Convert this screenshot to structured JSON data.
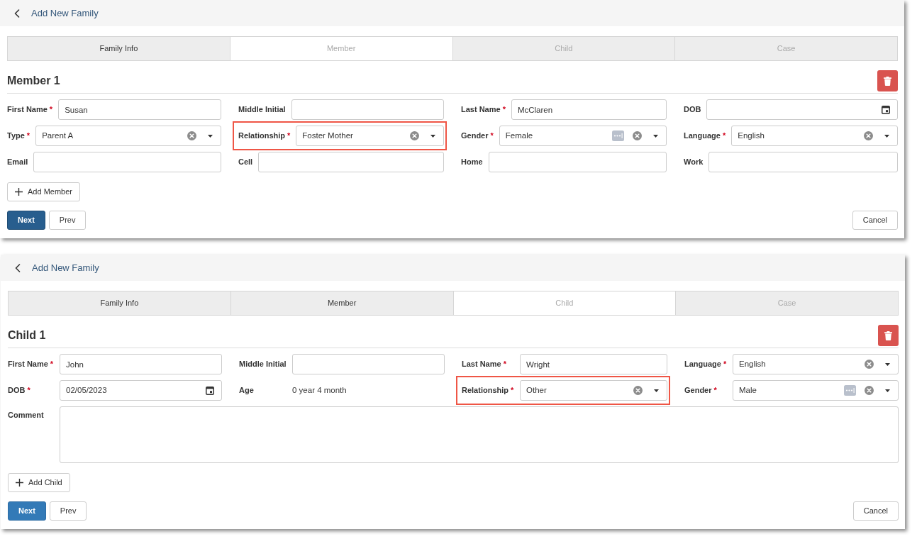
{
  "panels": [
    {
      "header": {
        "title": "Add New Family"
      },
      "tabs": [
        {
          "label": "Family Info",
          "selected": false,
          "completed": true
        },
        {
          "label": "Member",
          "selected": true,
          "completed": false
        },
        {
          "label": "Child",
          "selected": false,
          "completed": false
        },
        {
          "label": "Case",
          "selected": false,
          "completed": false
        }
      ],
      "section_title": "Member 1",
      "aligned_labels": false,
      "rows": [
        [
          {
            "kind": "text",
            "label": "First Name",
            "required_mark": "*",
            "value": "Susan",
            "highlighted": false
          },
          {
            "kind": "text",
            "label": "Middle Initial",
            "highlighted": false
          },
          {
            "kind": "text",
            "label": "Last Name",
            "required_mark": "*",
            "value": "McClaren",
            "highlighted": false
          },
          {
            "kind": "date",
            "label": "DOB",
            "highlighted": false
          }
        ],
        [
          {
            "kind": "select",
            "label": "Type",
            "required_mark": "*",
            "value": "Parent A",
            "more": false,
            "highlighted": false
          },
          {
            "kind": "select",
            "label": "Relationship",
            "required_mark": "*",
            "value": "Foster Mother",
            "more": false,
            "highlighted": true
          },
          {
            "kind": "select",
            "label": "Gender",
            "required_mark": "*",
            "value": "Female",
            "more": true,
            "highlighted": false
          },
          {
            "kind": "select",
            "label": "Language",
            "required_mark": "*",
            "value": "English",
            "more": false,
            "highlighted": false
          }
        ],
        [
          {
            "kind": "text",
            "label": "Email",
            "highlighted": false
          },
          {
            "kind": "text",
            "label": "Cell",
            "highlighted": false
          },
          {
            "kind": "text",
            "label": "Home",
            "highlighted": false
          },
          {
            "kind": "text",
            "label": "Work",
            "highlighted": false
          }
        ]
      ],
      "add_button": "Add Member",
      "next_button": {
        "label": "Next",
        "active": true
      },
      "prev_button": "Prev",
      "cancel_button": "Cancel"
    },
    {
      "header": {
        "title": "Add New Family"
      },
      "tabs": [
        {
          "label": "Family Info",
          "selected": false,
          "completed": true
        },
        {
          "label": "Member",
          "selected": false,
          "completed": true
        },
        {
          "label": "Child",
          "selected": true,
          "completed": false
        },
        {
          "label": "Case",
          "selected": false,
          "completed": false
        }
      ],
      "section_title": "Child 1",
      "aligned_labels": true,
      "rows": [
        [
          {
            "kind": "text",
            "label": "First Name",
            "required_mark": "*",
            "value": "John",
            "highlighted": false
          },
          {
            "kind": "text",
            "label": "Middle Initial",
            "highlighted": false
          },
          {
            "kind": "text",
            "label": "Last Name",
            "required_mark": "*",
            "value": "Wright",
            "highlighted": false
          },
          {
            "kind": "select",
            "label": "Language",
            "required_mark": "*",
            "value": "English",
            "more": false,
            "highlighted": false
          }
        ],
        [
          {
            "kind": "date",
            "label": "DOB",
            "required_mark": "*",
            "value": "02/05/2023",
            "highlighted": false
          },
          {
            "kind": "static",
            "label": "Age",
            "value": "0 year 4 month",
            "highlighted": false
          },
          {
            "kind": "select",
            "label": "Relationship",
            "required_mark": "*",
            "value": "Other",
            "more": false,
            "highlighted": true
          },
          {
            "kind": "select",
            "label": "Gender",
            "required_mark": "*",
            "value": "Male",
            "more": true,
            "highlighted": false
          }
        ],
        [
          {
            "kind": "textarea",
            "label": "Comment",
            "highlighted": false
          }
        ]
      ],
      "add_button": "Add Child",
      "next_button": {
        "label": "Next",
        "active": false
      },
      "prev_button": "Prev",
      "cancel_button": "Cancel"
    }
  ]
}
